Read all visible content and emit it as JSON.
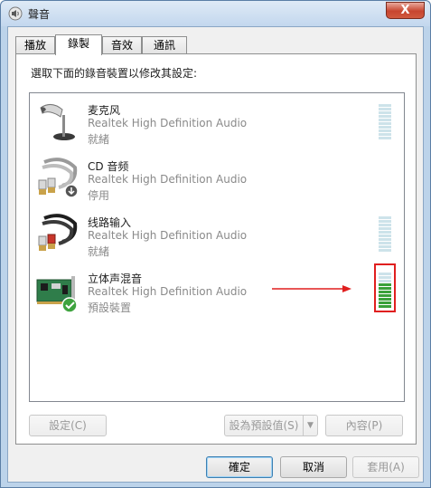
{
  "window": {
    "title": "聲音",
    "close_label": "X"
  },
  "tabs": [
    {
      "label": "播放",
      "active": false
    },
    {
      "label": "錄製",
      "active": true
    },
    {
      "label": "音效",
      "active": false
    },
    {
      "label": "通訊",
      "active": false
    }
  ],
  "instruction": "選取下面的錄音裝置以修改其設定:",
  "devices": [
    {
      "name": "麦克风",
      "driver": "Realtek High Definition Audio",
      "status": "就緒",
      "icon": "microphone-icon",
      "level": 0
    },
    {
      "name": "CD 音频",
      "driver": "Realtek High Definition Audio",
      "status": "停用",
      "icon": "cd-audio-cable-icon",
      "level": null
    },
    {
      "name": "线路输入",
      "driver": "Realtek High Definition Audio",
      "status": "就緒",
      "icon": "line-in-cable-icon",
      "level": 0
    },
    {
      "name": "立体声混音",
      "driver": "Realtek High Definition Audio",
      "status": "預設裝置",
      "icon": "sound-card-icon",
      "level": 0.7,
      "is_default": true
    }
  ],
  "buttons": {
    "configure": "設定(C)",
    "set_default": "設為預設值(S)",
    "properties": "內容(P)",
    "ok": "確定",
    "cancel": "取消",
    "apply": "套用(A)"
  },
  "colors": {
    "title_bar": "#c3d7ee",
    "close_button": "#c7452f",
    "meter_on": "#3aa13a",
    "meter_off": "#cde3ea",
    "highlight": "#e01f1f"
  }
}
